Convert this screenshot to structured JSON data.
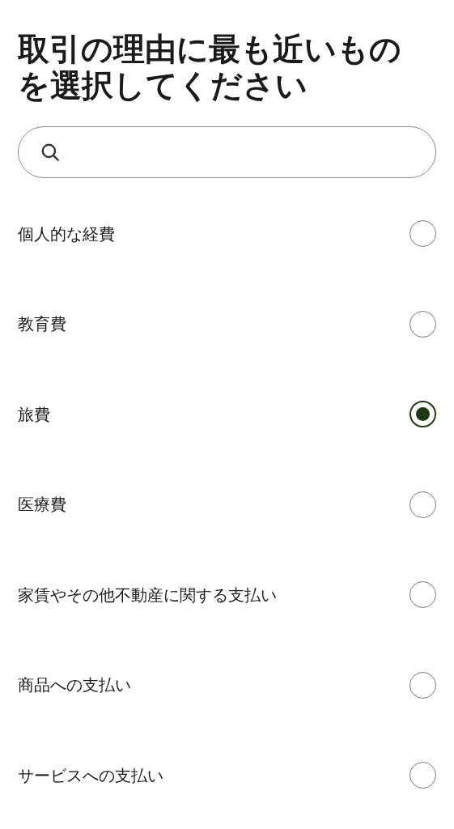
{
  "title": "取引の理由に最も近いものを選択してください",
  "options": [
    {
      "label": "個人的な経費",
      "selected": false
    },
    {
      "label": "教育費",
      "selected": false
    },
    {
      "label": "旅費",
      "selected": true
    },
    {
      "label": "医療費",
      "selected": false
    },
    {
      "label": "家賃やその他不動産に関する支払い",
      "selected": false
    },
    {
      "label": "商品への支払い",
      "selected": false
    },
    {
      "label": "サービスへの支払い",
      "selected": false
    }
  ]
}
